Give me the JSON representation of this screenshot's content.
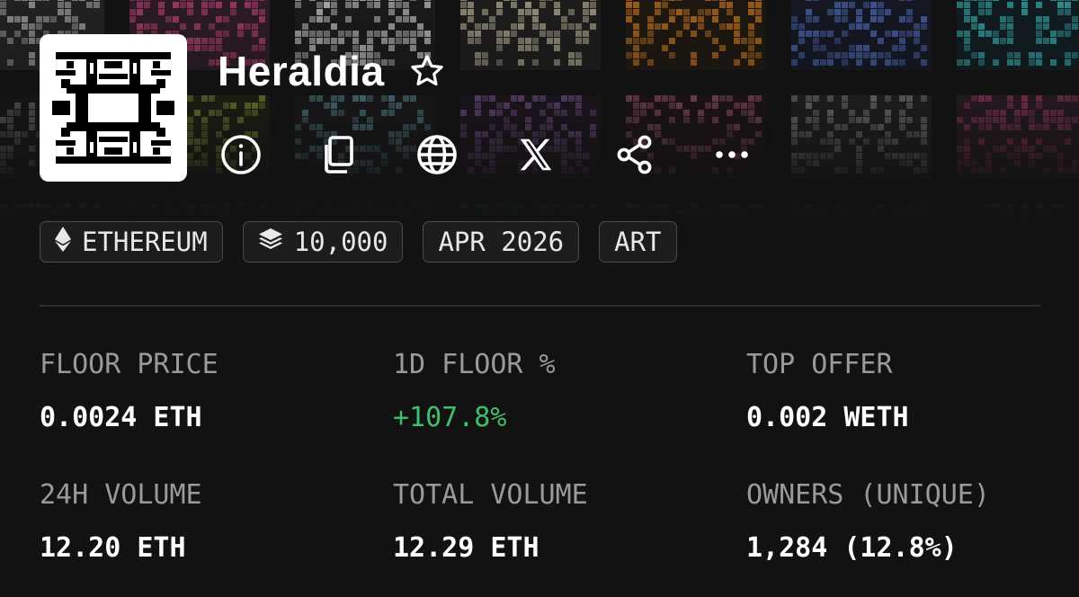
{
  "collection": {
    "name": "Heraldia",
    "favorite_icon": "star-outline-icon"
  },
  "actions": [
    {
      "name": "info-button",
      "icon": "info-circle-icon"
    },
    {
      "name": "copy-button",
      "icon": "copy-icon"
    },
    {
      "name": "website-button",
      "icon": "globe-icon"
    },
    {
      "name": "x-button",
      "icon": "x-logo-icon"
    },
    {
      "name": "share-button",
      "icon": "share-icon"
    },
    {
      "name": "more-button",
      "icon": "more-horizontal-icon"
    }
  ],
  "tags": {
    "chain": {
      "label": "ETHEREUM",
      "icon": "ethereum-icon"
    },
    "supply": {
      "label": "10,000",
      "icon": "layers-icon"
    },
    "date": {
      "label": "APR 2026"
    },
    "category": {
      "label": "ART"
    }
  },
  "stats": {
    "floor_price": {
      "label": "FLOOR PRICE",
      "value": "0.0024 ETH"
    },
    "floor_change": {
      "label": "1D FLOOR %",
      "value": "+107.8%"
    },
    "top_offer": {
      "label": "TOP OFFER",
      "value": "0.002 WETH"
    },
    "volume_24h": {
      "label": "24H VOLUME",
      "value": "12.20 ETH"
    },
    "total_volume": {
      "label": "TOTAL VOLUME",
      "value": "12.29 ETH"
    },
    "owners": {
      "label": "OWNERS (UNIQUE)",
      "value": "1,284 (12.8%)"
    }
  },
  "colors": {
    "background": "#121212",
    "positive": "#3fbf6a",
    "muted_text": "#9a9a9a",
    "tag_border": "#4a4a4a"
  },
  "banner_palette": [
    [
      "#2a2a2a",
      "#c8c8c8"
    ],
    [
      "#3a2030",
      "#e04a8a"
    ],
    [
      "#1e1e1e",
      "#f2f2f2"
    ],
    [
      "#222222",
      "#d8d0b0"
    ],
    [
      "#241a10",
      "#f08a20"
    ],
    [
      "#161a2c",
      "#5a7ad8"
    ],
    [
      "#102028",
      "#39d0d0"
    ],
    [
      "#202020",
      "#bdbdbd"
    ],
    [
      "#1a1a1a",
      "#9e9e9e"
    ],
    [
      "#202a10",
      "#c4d84a"
    ],
    [
      "#1c1c1c",
      "#7ec8d8"
    ],
    [
      "#221628",
      "#b070d0"
    ],
    [
      "#28121a",
      "#e07898"
    ]
  ]
}
